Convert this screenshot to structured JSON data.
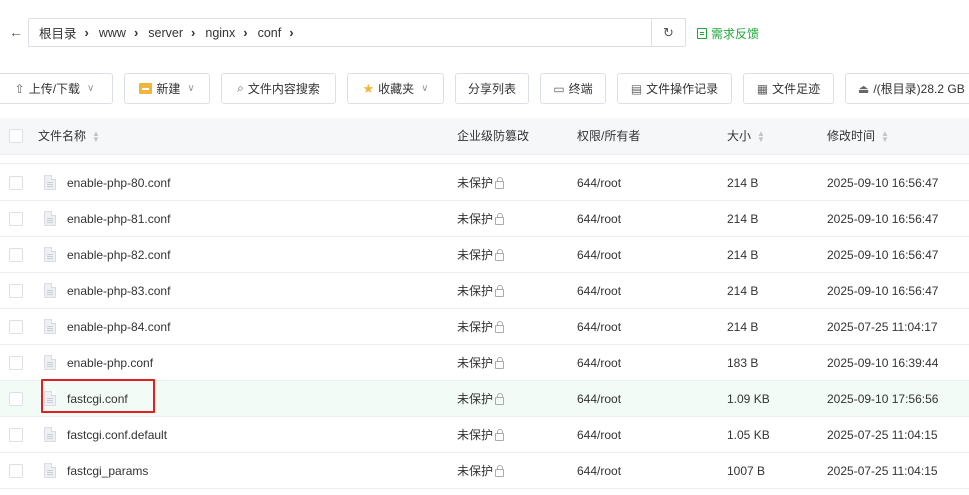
{
  "address_bar": {
    "back_icon": "arrow-left-icon",
    "breadcrumb": [
      "根目录",
      "www",
      "server",
      "nginx",
      "conf"
    ],
    "refresh_icon": "refresh-icon",
    "feedback_label": "需求反馈"
  },
  "toolbar": {
    "upload_label": "上传/下载",
    "new_label": "新建",
    "search_label": "文件内容搜索",
    "favorites_label": "收藏夹",
    "share_label": "分享列表",
    "terminal_label": "终端",
    "oplog_label": "文件操作记录",
    "footprint_label": "文件足迹",
    "disk_label": "/(根目录)28.2 GB"
  },
  "table": {
    "columns": {
      "name": "文件名称",
      "tamper": "企业级防篡改",
      "perm": "权限/所有者",
      "size": "大小",
      "mtime": "修改时间"
    },
    "rows": [
      {
        "name": "enable-php-80.conf",
        "tamper": "未保护",
        "perm": "644/root",
        "size": "214 B",
        "mtime": "2025-09-10 16:56:47"
      },
      {
        "name": "enable-php-81.conf",
        "tamper": "未保护",
        "perm": "644/root",
        "size": "214 B",
        "mtime": "2025-09-10 16:56:47"
      },
      {
        "name": "enable-php-82.conf",
        "tamper": "未保护",
        "perm": "644/root",
        "size": "214 B",
        "mtime": "2025-09-10 16:56:47"
      },
      {
        "name": "enable-php-83.conf",
        "tamper": "未保护",
        "perm": "644/root",
        "size": "214 B",
        "mtime": "2025-09-10 16:56:47"
      },
      {
        "name": "enable-php-84.conf",
        "tamper": "未保护",
        "perm": "644/root",
        "size": "214 B",
        "mtime": "2025-07-25 11:04:17"
      },
      {
        "name": "enable-php.conf",
        "tamper": "未保护",
        "perm": "644/root",
        "size": "183 B",
        "mtime": "2025-09-10 16:39:44"
      },
      {
        "name": "fastcgi.conf",
        "tamper": "未保护",
        "perm": "644/root",
        "size": "1.09 KB",
        "mtime": "2025-09-10 17:56:56"
      },
      {
        "name": "fastcgi.conf.default",
        "tamper": "未保护",
        "perm": "644/root",
        "size": "1.05 KB",
        "mtime": "2025-07-25 11:04:15"
      },
      {
        "name": "fastcgi_params",
        "tamper": "未保护",
        "perm": "644/root",
        "size": "1007 B",
        "mtime": "2025-07-25 11:04:15"
      }
    ]
  },
  "colors": {
    "accent_green": "#20a53a",
    "highlight_row": "#f2fbf5",
    "annotation_red": "#e02020"
  }
}
